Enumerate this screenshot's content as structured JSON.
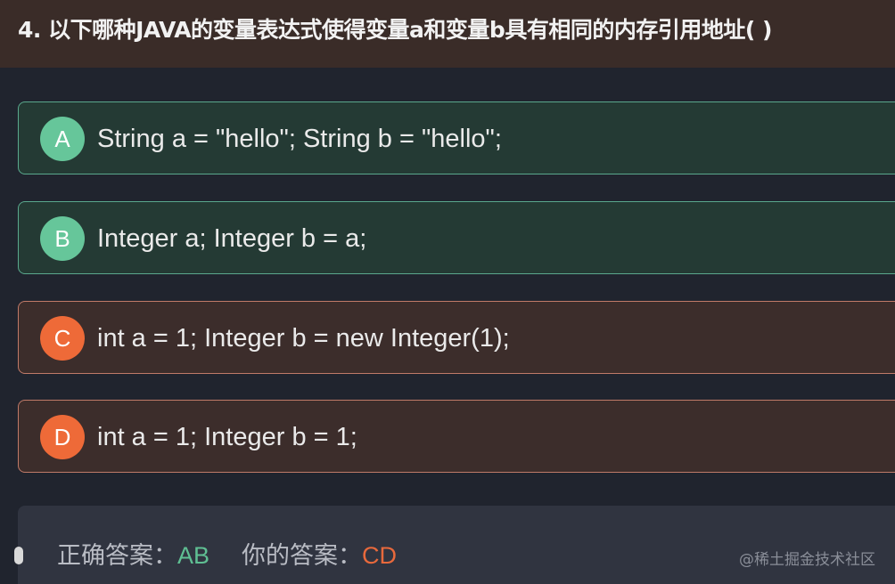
{
  "question": {
    "title": "4. 以下哪种JAVA的变量表达式使得变量a和变量b具有相同的内存引用地址( )"
  },
  "options": [
    {
      "letter": "A",
      "text": "String a = \"hello\"; String b = \"hello\";",
      "status": "correct"
    },
    {
      "letter": "B",
      "text": "Integer a; Integer b = a;",
      "status": "correct"
    },
    {
      "letter": "C",
      "text": "int a = 1; Integer b = new Integer(1);",
      "status": "wrong"
    },
    {
      "letter": "D",
      "text": "int a = 1; Integer b = 1;",
      "status": "wrong"
    }
  ],
  "answer": {
    "correct_label": "正确答案：",
    "correct_value": "AB",
    "yours_label": "你的答案：",
    "yours_value": "CD"
  },
  "watermark": "@稀土掘金技术社区",
  "colors": {
    "correct": "#66c69a",
    "wrong": "#ee6a38",
    "background": "#20242e",
    "header": "#3a2c28"
  }
}
